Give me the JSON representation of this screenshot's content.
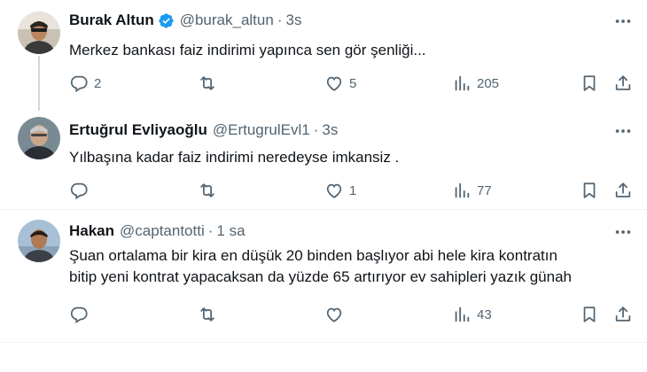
{
  "tweets": [
    {
      "name": "Burak Altun",
      "handle": "@burak_altun",
      "dot": "·",
      "time": "3s",
      "verified": true,
      "text": "Merkez bankası faiz indirimi yapınca sen gör şenliği...",
      "replies": "2",
      "retweets": "",
      "likes": "5",
      "views": "205"
    },
    {
      "name": "Ertuğrul Evliyaoğlu",
      "handle": "@ErtugrulEvl1",
      "dot": "·",
      "time": "3s",
      "verified": false,
      "text": "Yılbaşına kadar faiz indirimi neredeyse imkansiz .",
      "replies": "",
      "retweets": "",
      "likes": "1",
      "views": "77"
    },
    {
      "name": "Hakan",
      "handle": "@captantotti",
      "dot": "·",
      "time": "1 sa",
      "verified": false,
      "text_line1": "Şuan ortalama bir kira en düşük 20 binden başlıyor abi hele kira kontratın",
      "text_line2": "bitip yeni kontrat yapacaksan da yüzde 65 artırıyor ev sahipleri yazık günah",
      "replies": "",
      "retweets": "",
      "likes": "",
      "views": "43"
    }
  ],
  "colors": {
    "text": "#0f1419",
    "secondary": "#536471",
    "verified": "#1d9bf0",
    "divider": "#eff3f4",
    "thread_line": "#cfd9de"
  },
  "icons": [
    "verified-badge-icon",
    "more-icon",
    "reply-icon",
    "retweet-icon",
    "like-icon",
    "views-icon",
    "bookmark-icon",
    "share-icon"
  ]
}
